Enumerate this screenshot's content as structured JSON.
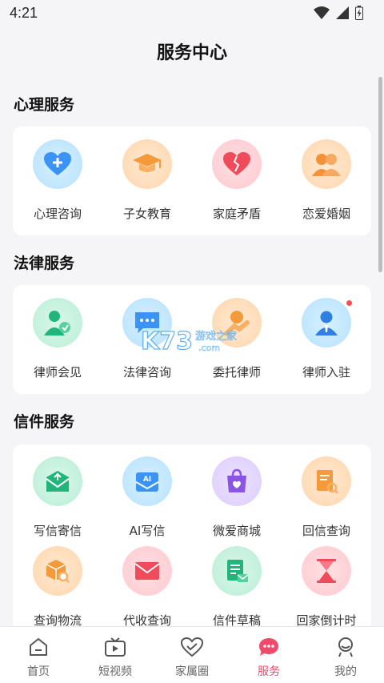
{
  "status_bar": {
    "time": "4:21"
  },
  "page_title": "服务中心",
  "sections": [
    {
      "title": "心理服务",
      "items": [
        {
          "label": "心理咨询",
          "icon": "heart-plus-icon"
        },
        {
          "label": "子女教育",
          "icon": "graduation-cap-icon"
        },
        {
          "label": "家庭矛盾",
          "icon": "broken-heart-icon"
        },
        {
          "label": "恋爱婚姻",
          "icon": "couple-icon"
        }
      ]
    },
    {
      "title": "法律服务",
      "items": [
        {
          "label": "律师会见",
          "icon": "lawyer-meeting-icon"
        },
        {
          "label": "法律咨询",
          "icon": "chat-bubble-icon"
        },
        {
          "label": "委托律师",
          "icon": "handshake-icon"
        },
        {
          "label": "律师入驻",
          "icon": "lawyer-icon",
          "has_dot": true
        }
      ]
    },
    {
      "title": "信件服务",
      "items": [
        {
          "label": "写信寄信",
          "icon": "mailbox-icon"
        },
        {
          "label": "AI写信",
          "icon": "ai-mail-icon"
        },
        {
          "label": "微爱商城",
          "icon": "shopping-bag-icon"
        },
        {
          "label": "回信查询",
          "icon": "document-search-icon"
        },
        {
          "label": "查询物流",
          "icon": "package-search-icon"
        },
        {
          "label": "代收查询",
          "icon": "envelope-icon"
        },
        {
          "label": "信件草稿",
          "icon": "draft-icon"
        },
        {
          "label": "回家倒计时",
          "icon": "hourglass-icon"
        }
      ]
    }
  ],
  "bottom_nav": [
    {
      "label": "首页",
      "icon": "home-icon",
      "active": false
    },
    {
      "label": "短视频",
      "icon": "video-icon",
      "active": false
    },
    {
      "label": "家属圈",
      "icon": "hearts-icon",
      "active": false
    },
    {
      "label": "服务",
      "icon": "service-chat-icon",
      "active": true
    },
    {
      "label": "我的",
      "icon": "profile-icon",
      "active": false
    }
  ],
  "watermark": {
    "logo": "K73",
    "text": "游戏之家",
    "sub": ".com"
  },
  "colors": {
    "accent": "#f04a6b",
    "card": "#ffffff",
    "background": "#f5f5f7"
  }
}
